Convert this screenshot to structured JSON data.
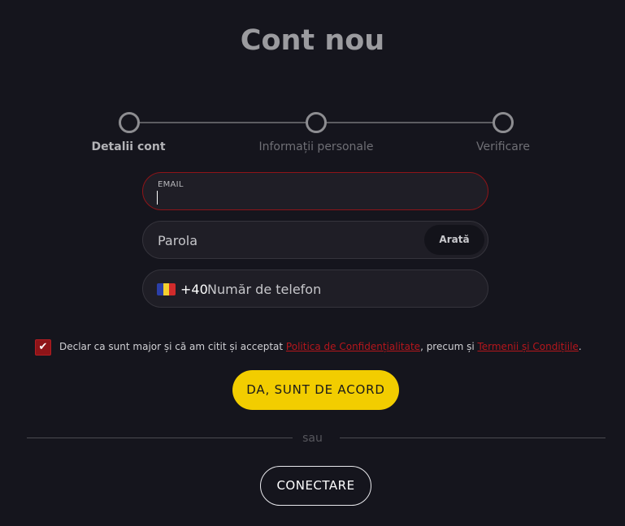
{
  "header": {
    "title": "Cont nou"
  },
  "stepper": {
    "steps": [
      {
        "label": "Detalii cont",
        "active": true
      },
      {
        "label": "Informații personale",
        "active": false
      },
      {
        "label": "Verificare",
        "active": false
      }
    ]
  },
  "form": {
    "email": {
      "label": "EMAIL",
      "value": ""
    },
    "password": {
      "placeholder": "Parola",
      "show_label": "Arată"
    },
    "phone": {
      "prefix": "+40",
      "placeholder": "Număr de telefon",
      "flag_icon": "romania-flag-icon"
    }
  },
  "consent": {
    "checked": true,
    "text_before": "Declar ca sunt major și că am citit și acceptat ",
    "privacy_link": "Politica de Confidențialitate",
    "text_middle": ", precum și ",
    "terms_link": "Termenii și Condițiile",
    "text_after": "."
  },
  "actions": {
    "agree_label": "DA, SUNT DE ACORD",
    "or_label": "sau",
    "login_label": "CONECTARE"
  },
  "colors": {
    "background": "#15151d",
    "accent_yellow": "#f2cd00",
    "error_red": "#8e1418",
    "link_red": "#b5161c"
  }
}
